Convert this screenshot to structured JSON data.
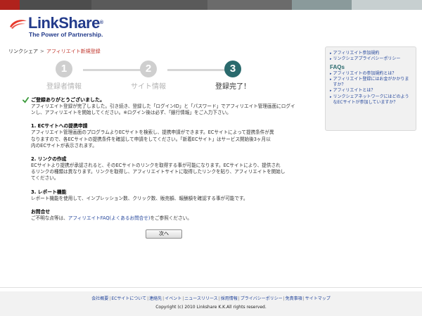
{
  "colors": {
    "brand_navy": "#233b8b",
    "brand_red": "#e8382b",
    "active_step": "#2a6a6d",
    "inactive_step": "#cfcfcf",
    "link": "#23459b",
    "topbar": [
      "#b0221c",
      "#4d4d4d",
      "#5a5a5a",
      "#6b6b6b",
      "#8a9a9b",
      "#c7cfd0"
    ]
  },
  "logo": {
    "name": "LinkShare",
    "registered": "®",
    "tagline": "The Power of Partnership."
  },
  "breadcrumb": {
    "home": "リンクシェア",
    "separator": ">",
    "current": "アフィリエイト新規登録"
  },
  "steps": [
    {
      "number": "1",
      "label": "登録者情報",
      "active": false
    },
    {
      "number": "2",
      "label": "サイト情報",
      "active": false
    },
    {
      "number": "3",
      "label": "登録完了！",
      "active": true
    }
  ],
  "main": {
    "thanks_title": "ご登録ありがとうございました。",
    "intro_lines": [
      "アフィリエイト登録が完了しました。引き続き、登録した「ログインID」と「パスワード」でアフィリエイト管理画面にログイ",
      "ンし、アフィリエイトを開始してください。※ログイン後は必ず、「銀行情報」をご入力下さい。"
    ],
    "sections": [
      {
        "title": "1. ECサイトへの提携申請",
        "lines": [
          "アフィリエイト管理画面のプログラムよりECサイトを検索し、提携申請ができます。ECサイトによって提携条件が異",
          "なりますので、各ECサイトの提携条件を確認して申請をしてください。「新着ECサイト」はサービス開始後3ヶ月以",
          "内のECサイトが表示されます。"
        ]
      },
      {
        "title": "2. リンクの作成",
        "lines": [
          "ECサイトより提携が承認されると、そのECサイトのリンクを取得する事が可能になります。ECサイトにより、提供され",
          "るリンクの種類は異なります。リンクを取得し、アフィリエイトサイトに取得したリンクを貼り、アフィリエイトを開始し",
          "てください。"
        ]
      },
      {
        "title": "3. レポート機能",
        "lines": [
          "レポート機能を使用して、インプレッション数、クリック数、販売額、報酬額を確認する事が可能です。"
        ]
      }
    ],
    "contact": {
      "title": "お問合せ",
      "prefix": "ご不明な点等は、",
      "link": "アフィリエイトFAQ(よくあるお問合せ)",
      "suffix": "をご参照ください。"
    },
    "next_button": "次へ"
  },
  "sidebar": {
    "top_links": [
      "アフィリエイト参加規約",
      "リンクシェアプライバシーポリシー"
    ],
    "faqs_title": "FAQs",
    "faq_links": [
      "アフィリエイトの参加規約とは？",
      "アフィリエイト登録にはお金がかかりますか？",
      "アフィリエイトとは？",
      "リンクシェアネットワークにはどのようなECサイトが参加していますか？"
    ]
  },
  "footer": {
    "links": [
      "会社概要",
      "ECサイトについて",
      "連絡先",
      "イベント",
      "ニュースリリース",
      "採用情報",
      "プライバシーポリシー",
      "免責事項",
      "サイトマップ"
    ],
    "copyright": "Copyright (c) 2010 Linkshare K.K.All rights reserved."
  }
}
